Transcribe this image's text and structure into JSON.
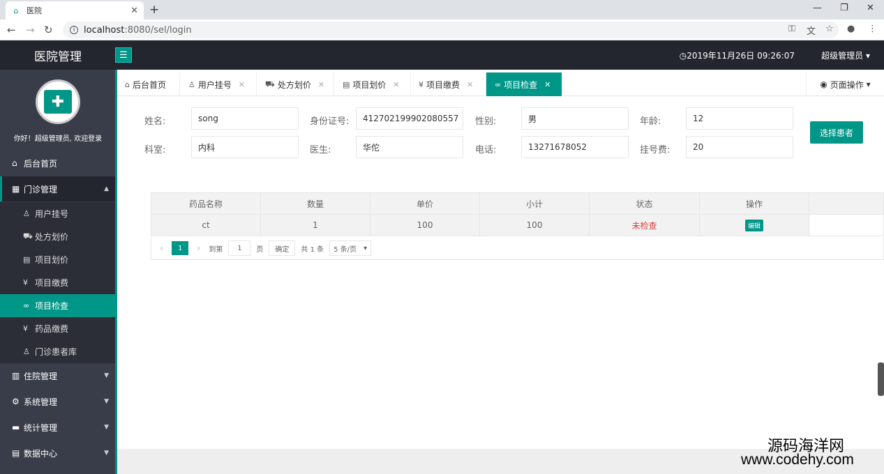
{
  "browser": {
    "tab_title": "医院",
    "url_host": "localhost",
    "url_rest": ":8080/sel/login"
  },
  "header": {
    "logo": "医院管理",
    "datetime": "2019年11月26日 09:26:07",
    "user": "超级管理员"
  },
  "sidebar": {
    "welcome": "你好！超级管理员, 欢迎登录",
    "home": "后台首页",
    "groups": [
      {
        "label": "门诊管理"
      },
      {
        "label": "住院管理"
      },
      {
        "label": "系统管理"
      },
      {
        "label": "统计管理"
      },
      {
        "label": "数据中心"
      }
    ],
    "subitems": [
      {
        "label": "用户挂号"
      },
      {
        "label": "处方划价"
      },
      {
        "label": "项目划价"
      },
      {
        "label": "项目缴费"
      },
      {
        "label": "项目检查"
      },
      {
        "label": "药品缴费"
      },
      {
        "label": "门诊患者库"
      }
    ]
  },
  "tabs": [
    {
      "label": "后台首页"
    },
    {
      "label": "用户挂号"
    },
    {
      "label": "处方划价"
    },
    {
      "label": "项目划价"
    },
    {
      "label": "项目缴费"
    },
    {
      "label": "项目检查"
    }
  ],
  "page_ops": "页面操作",
  "form": {
    "name_label": "姓名:",
    "name": "song",
    "id_label": "身份证号:",
    "id": "412702199902080557",
    "gender_label": "性别:",
    "gender": "男",
    "age_label": "年龄:",
    "age": "12",
    "dept_label": "科室:",
    "dept": "内科",
    "doctor_label": "医生:",
    "doctor": "华佗",
    "phone_label": "电话:",
    "phone": "13271678052",
    "fee_label": "挂号费:",
    "fee": "20",
    "select_button": "选择患者"
  },
  "table": {
    "headers": [
      "药品名称",
      "数量",
      "单价",
      "小计",
      "状态",
      "操作"
    ],
    "rows": [
      {
        "name": "ct",
        "qty": "1",
        "price": "100",
        "subtotal": "100",
        "status": "未检查",
        "action": "编辑"
      }
    ]
  },
  "pager": {
    "current": "1",
    "goto_label": "到第",
    "goto_value": "1",
    "page_label": "页",
    "confirm": "确定",
    "total": "共 1 条",
    "per_page": "5 条/页"
  },
  "watermark": {
    "cn": "源码海洋网",
    "url": "www.codehy.com"
  },
  "colors": {
    "accent": "#009688",
    "header_bg": "#23262e",
    "sidebar_bg": "#393d49",
    "status_red": "#e5383b"
  }
}
